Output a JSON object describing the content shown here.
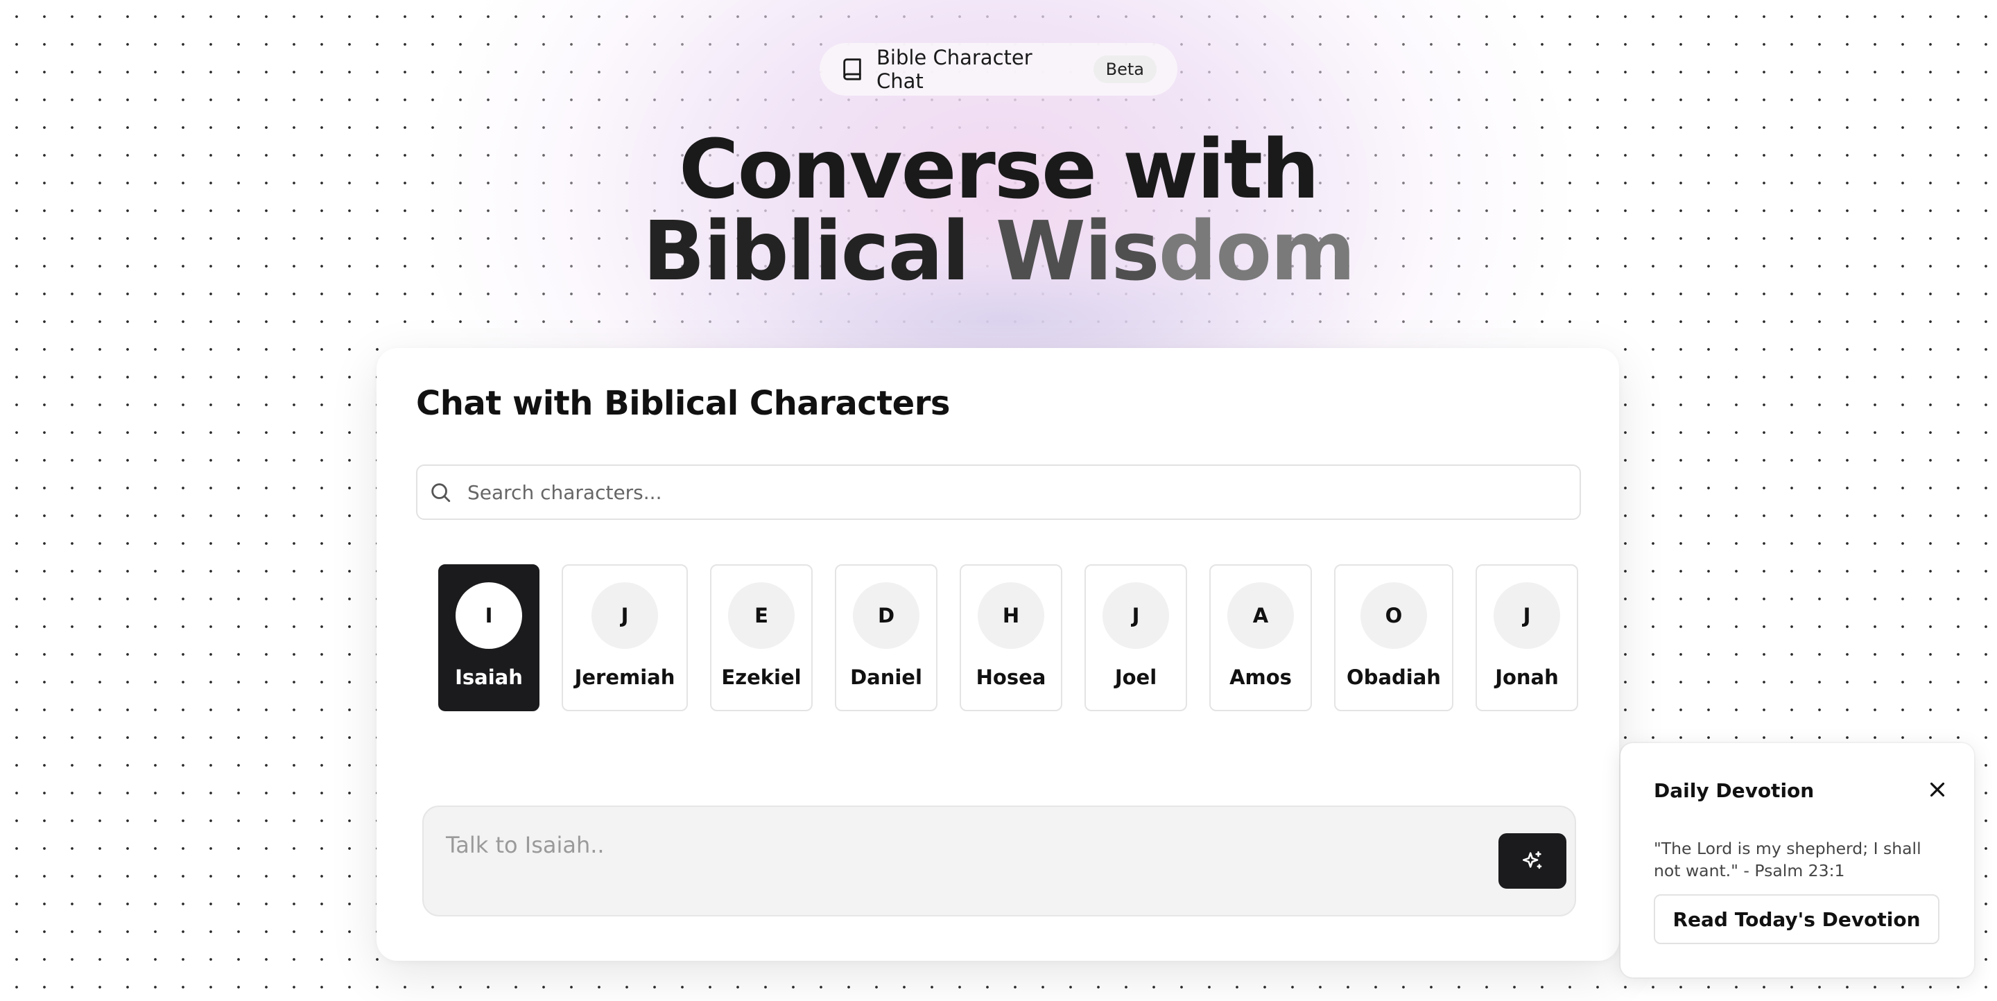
{
  "header": {
    "app_name": "Bible Character Chat",
    "badge": "Beta",
    "icon": "book-icon"
  },
  "hero": {
    "line1": "Converse with",
    "line2_word1": "Biblical",
    "line2_word2a": "Wis",
    "line2_word2b": "dom"
  },
  "chat_card": {
    "title": "Chat with Biblical Characters",
    "search": {
      "placeholder": "Search characters...",
      "icon": "search-icon"
    },
    "selected": "Isaiah",
    "characters": [
      {
        "initial": "I",
        "name": "Isaiah"
      },
      {
        "initial": "J",
        "name": "Jeremiah"
      },
      {
        "initial": "E",
        "name": "Ezekiel"
      },
      {
        "initial": "D",
        "name": "Daniel"
      },
      {
        "initial": "H",
        "name": "Hosea"
      },
      {
        "initial": "J",
        "name": "Joel"
      },
      {
        "initial": "A",
        "name": "Amos"
      },
      {
        "initial": "O",
        "name": "Obadiah"
      },
      {
        "initial": "J",
        "name": "Jonah"
      }
    ],
    "message": {
      "placeholder": "Talk to Isaiah..",
      "value": ""
    },
    "send_icon": "sparkles-icon"
  },
  "devotion": {
    "title": "Daily Devotion",
    "verse": "\"The Lord is my shepherd; I shall not want.\" - Psalm 23:1",
    "button": "Read Today's Devotion",
    "close_icon": "close-icon"
  },
  "colors": {
    "primary": "#1b1b1d",
    "background": "#ffffff",
    "glow": "#f0d6f0"
  }
}
